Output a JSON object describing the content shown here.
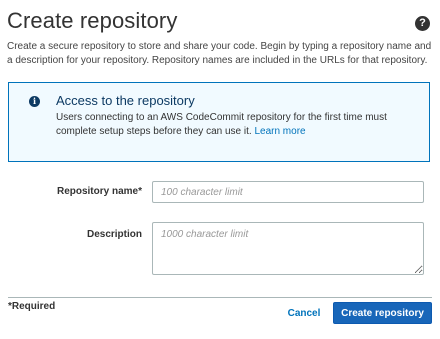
{
  "page": {
    "title": "Create repository",
    "intro": "Create a secure repository to store and share your code. Begin by typing a repository name and a description for your repository. Repository names are included in the URLs for that repository."
  },
  "help": {
    "icon": "question-circle-icon",
    "glyph": "?"
  },
  "info": {
    "icon": "info-circle-icon",
    "glyph": "i",
    "title": "Access to the repository",
    "body": "Users connecting to an AWS CodeCommit repository for the first time must complete setup steps before they can use it.",
    "link": "Learn more"
  },
  "form": {
    "repository_name": {
      "label": "Repository name*",
      "value": "",
      "placeholder": "100 character limit"
    },
    "description": {
      "label": "Description",
      "value": "",
      "placeholder": "1000 character limit"
    }
  },
  "footer": {
    "required_note": "*Required",
    "cancel_label": "Cancel",
    "create_label": "Create repository"
  },
  "colors": {
    "accent": "#0073bb",
    "primary_button": "#1866b9",
    "info_background": "#f1faff",
    "info_title": "#0d3a63"
  }
}
